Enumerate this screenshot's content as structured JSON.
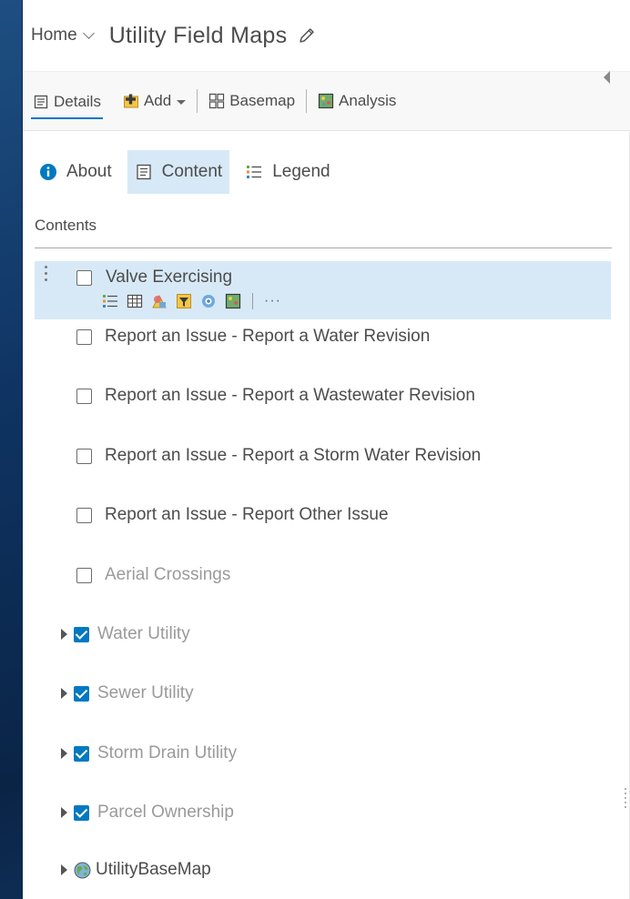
{
  "header": {
    "home_label": "Home",
    "map_title": "Utility Field Maps"
  },
  "toolbar": {
    "details_label": "Details",
    "add_label": "Add",
    "basemap_label": "Basemap",
    "analysis_label": "Analysis"
  },
  "tabs": {
    "about_label": "About",
    "content_label": "Content",
    "legend_label": "Legend",
    "active": "Content"
  },
  "contents": {
    "heading": "Contents",
    "layers": [
      {
        "name": "Valve Exercising",
        "checked": false,
        "expandable": false,
        "dimmed": false,
        "selected": true
      },
      {
        "name": "Report an Issue - Report a Water Revision",
        "checked": false,
        "expandable": false,
        "dimmed": false
      },
      {
        "name": "Report an Issue - Report a Wastewater Revision",
        "checked": false,
        "expandable": false,
        "dimmed": false
      },
      {
        "name": "Report an Issue - Report a Storm Water Revision",
        "checked": false,
        "expandable": false,
        "dimmed": false
      },
      {
        "name": "Report an Issue - Report Other Issue",
        "checked": false,
        "expandable": false,
        "dimmed": false
      },
      {
        "name": "Aerial Crossings",
        "checked": false,
        "expandable": false,
        "dimmed": true
      },
      {
        "name": "Water Utility",
        "checked": true,
        "expandable": true,
        "dimmed": true
      },
      {
        "name": "Sewer Utility",
        "checked": true,
        "expandable": true,
        "dimmed": true
      },
      {
        "name": "Storm Drain Utility",
        "checked": true,
        "expandable": true,
        "dimmed": true
      },
      {
        "name": "Parcel Ownership",
        "checked": true,
        "expandable": true,
        "dimmed": true
      },
      {
        "name": "UtilityBaseMap",
        "checked": true,
        "expandable": true,
        "dimmed": false,
        "icon": "globe-icon"
      }
    ],
    "selected_layer_tools": [
      "show-legend-icon",
      "show-table-icon",
      "change-style-icon",
      "filter-icon",
      "perform-analysis-icon",
      "show-map-details-icon",
      "more-options-icon"
    ]
  },
  "colors": {
    "accent": "#0079c1",
    "selected_bg": "#d7e9f6",
    "background": "#0f3463"
  }
}
